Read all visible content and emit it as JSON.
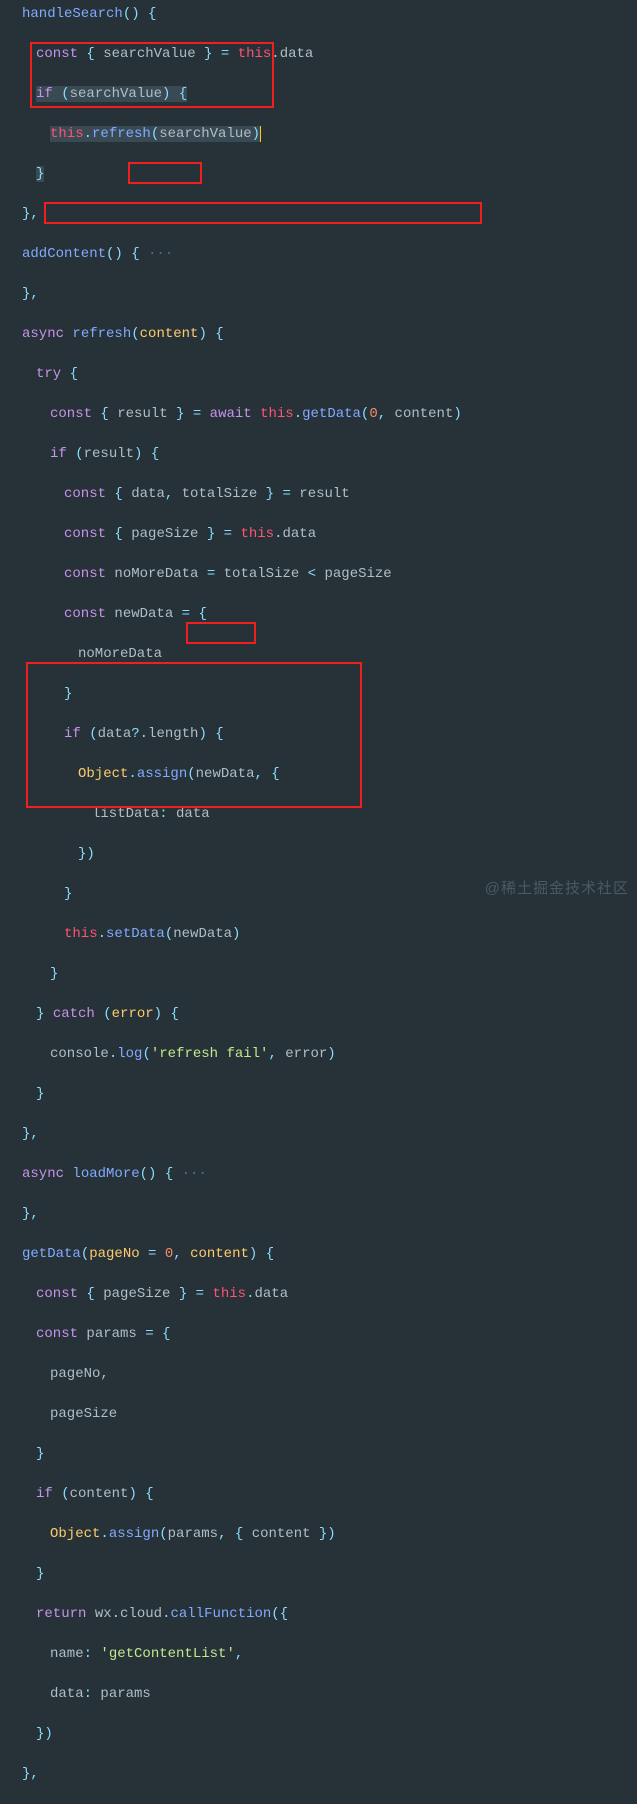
{
  "watermark": "@稀土掘金技术社区",
  "code": {
    "l1": {
      "fn": "handleSearch",
      "rest": "() {"
    },
    "l2": {
      "kw": "const",
      "destruct": "searchValue",
      "eq": " = ",
      "this": "this",
      "dot": ".",
      "prop": "data"
    },
    "l3": {
      "kw": "if",
      "open": " (",
      "var": "searchValue",
      "close": ") {"
    },
    "l4": {
      "this": "this",
      "dot": ".",
      "fn": "refresh",
      "open": "(",
      "arg": "searchValue",
      "close": ")"
    },
    "l5": "}",
    "l6": "},",
    "l7": {
      "fn": "addContent",
      "rest": "() {",
      "fold": " ···"
    },
    "l8": "},",
    "l9": {
      "kw": "async",
      "fn": "refresh",
      "open": "(",
      "param": "content",
      "close": ") {"
    },
    "l10": {
      "kw": "try",
      "brace": " {"
    },
    "l11": {
      "kw": "const",
      "open": " { ",
      "var": "result",
      "close": " } = ",
      "await": "await",
      "sp": " ",
      "this": "this",
      "dot": ".",
      "fn": "getData",
      "p1": "(",
      "num": "0",
      "comma": ", ",
      "arg": "content",
      "p2": ")"
    },
    "l12": {
      "kw": "if",
      "open": " (",
      "var": "result",
      "close": ") {"
    },
    "l13": {
      "kw": "const",
      "open": " { ",
      "v1": "data",
      "c": ", ",
      "v2": "totalSize",
      "close": " } = ",
      "id": "result"
    },
    "l14": {
      "kw": "const",
      "open": " { ",
      "v1": "pageSize",
      "close": " } = ",
      "this": "this",
      "dot": ".",
      "prop": "data"
    },
    "l15": {
      "kw": "const",
      "sp": " ",
      "id": "noMoreData",
      "eq": " = ",
      "a": "totalSize",
      "op": " < ",
      "b": "pageSize"
    },
    "l16": {
      "kw": "const",
      "sp": " ",
      "id": "newData",
      "eq": " = {"
    },
    "l17": "noMoreData",
    "l18": "}",
    "l19": {
      "kw": "if",
      "open": " (",
      "a": "data",
      "op": "?.",
      "b": "length",
      "close": ") {"
    },
    "l20": {
      "obj": "Object",
      "dot": ".",
      "fn": "assign",
      "open": "(",
      "a": "newData",
      "c": ", {"
    },
    "l21": {
      "key": "listData",
      "colon": ": ",
      "val": "data"
    },
    "l22": "})",
    "l23": "}",
    "l24": {
      "this": "this",
      "dot": ".",
      "fn": "setData",
      "open": "(",
      "arg": "newData",
      "close": ")"
    },
    "l25": "}",
    "l26": {
      "close": "} ",
      "kw": "catch",
      "open": " (",
      "param": "error",
      "close2": ") {"
    },
    "l27": {
      "obj": "console",
      "dot": ".",
      "fn": "log",
      "open": "(",
      "str": "'refresh fail'",
      "c": ", ",
      "arg": "error",
      "close": ")"
    },
    "l28": "}",
    "l29": "},",
    "l30": {
      "kw": "async",
      "fn": "loadMore",
      "rest": "() {",
      "fold": " ···"
    },
    "l31": "},",
    "l32": {
      "fn": "getData",
      "open": "(",
      "p1": "pageNo",
      "eq": " = ",
      "num": "0",
      "c": ", ",
      "p2": "content",
      "close": ") {"
    },
    "l33": {
      "kw": "const",
      "open": " { ",
      "v": "pageSize",
      "close": " } = ",
      "this": "this",
      "dot": ".",
      "prop": "data"
    },
    "l34": {
      "kw": "const",
      "sp": " ",
      "id": "params",
      "eq": " = {"
    },
    "l35": "pageNo,",
    "l36": "pageSize",
    "l37": "}",
    "l38": {
      "kw": "if",
      "open": " (",
      "var": "content",
      "close": ") {"
    },
    "l39": {
      "obj": "Object",
      "dot": ".",
      "fn": "assign",
      "open": "(",
      "a": "params",
      "c": ", { ",
      "key": "content",
      "close": " })"
    },
    "l40": "}",
    "l41": {
      "kw": "return",
      "sp": " ",
      "a": "wx",
      "d1": ".",
      "b": "cloud",
      "d2": ".",
      "fn": "callFunction",
      "open": "({"
    },
    "l42": {
      "key": "name",
      "colon": ": ",
      "str": "'getContentList'",
      "c": ","
    },
    "l43": {
      "key": "data",
      "colon": ": ",
      "val": "params"
    },
    "l44": "})",
    "l45": "},"
  }
}
